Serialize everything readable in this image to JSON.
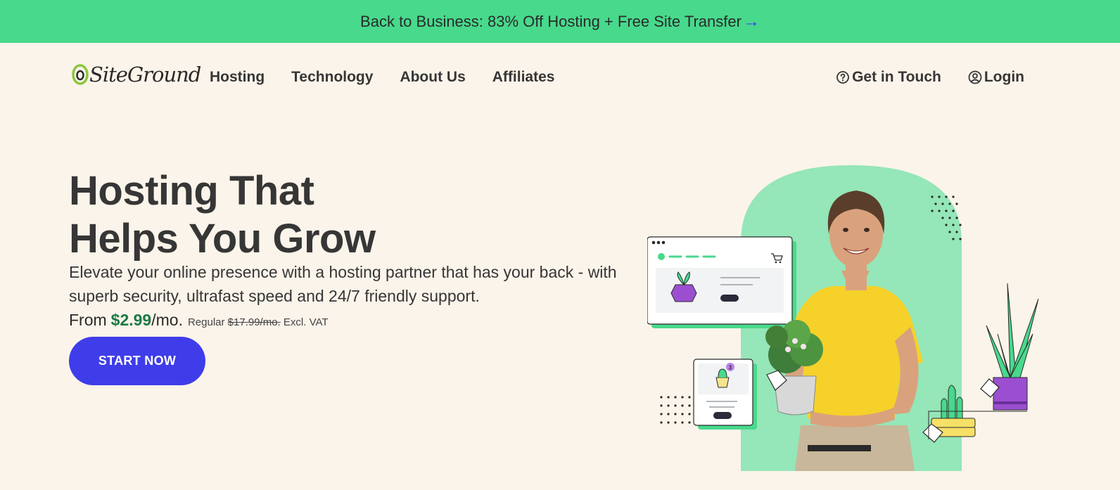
{
  "promo": {
    "text": "Back to Business: 83% Off Hosting + Free Site Transfer",
    "arrow": "→"
  },
  "logo": {
    "text": "SiteGround"
  },
  "nav": {
    "items": [
      {
        "label": "Hosting"
      },
      {
        "label": "Technology"
      },
      {
        "label": "About Us"
      },
      {
        "label": "Affiliates"
      }
    ],
    "contact": {
      "label": "Get in Touch",
      "icon": "question-circle-icon"
    },
    "login": {
      "label": "Login",
      "icon": "user-circle-icon"
    }
  },
  "hero": {
    "title_line1": "Hosting That",
    "title_line2": "Helps You Grow",
    "subtitle": "Elevate your online presence with a hosting partner that has your back - with superb security, ultrafast speed and 24/7 friendly support.",
    "price_prefix": "From",
    "price": "$2.99",
    "price_suffix": "/mo.",
    "regular_label": "Regular",
    "regular_price": "$17.99/mo.",
    "vat_note": "Excl. VAT",
    "cta": "START NOW",
    "badge_count": "3"
  },
  "colors": {
    "promo_bg": "#48d98c",
    "page_bg": "#fbf4ea",
    "accent_blue": "#3f3de9",
    "price_green": "#1c7a45",
    "art_green": "#95e6b8",
    "shirt_yellow": "#f6d129",
    "pot_purple": "#9b4fd0"
  }
}
